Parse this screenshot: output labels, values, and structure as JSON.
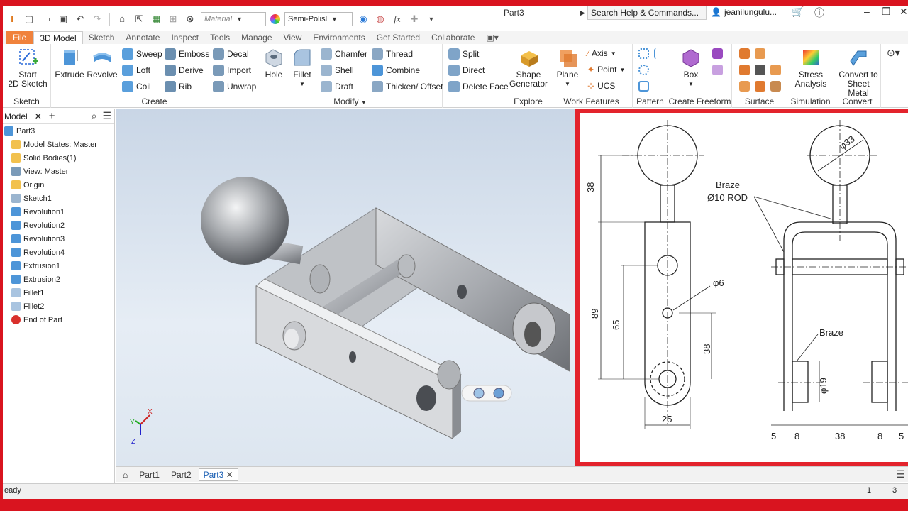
{
  "qat": {
    "material_placeholder": "Material",
    "appearance_value": "Semi-Polisl",
    "doc_title": "Part3",
    "search_placeholder": "Search Help & Commands...",
    "user_name": "jeanilungulu..."
  },
  "ribbon_tabs": [
    "File",
    "3D Model",
    "Sketch",
    "Annotate",
    "Inspect",
    "Tools",
    "Manage",
    "View",
    "Environments",
    "Get Started",
    "Collaborate"
  ],
  "ribbon": {
    "sketch": {
      "label": "Sketch",
      "start_line1": "Start",
      "start_line2": "2D Sketch"
    },
    "create": {
      "label": "Create",
      "extrude": "Extrude",
      "revolve": "Revolve",
      "sweep": "Sweep",
      "loft": "Loft",
      "coil": "Coil",
      "emboss": "Emboss",
      "derive": "Derive",
      "rib": "Rib",
      "decal": "Decal",
      "import": "Import",
      "unwrap": "Unwrap"
    },
    "modify": {
      "label": "Modify",
      "hole": "Hole",
      "fillet": "Fillet",
      "chamfer": "Chamfer",
      "shell": "Shell",
      "draft": "Draft",
      "thread": "Thread",
      "combine": "Combine",
      "thicken": "Thicken/ Offset",
      "split": "Split",
      "direct": "Direct",
      "delete_face": "Delete Face"
    },
    "explore": {
      "label": "Explore",
      "shape_line1": "Shape",
      "shape_line2": "Generator"
    },
    "work_features": {
      "label": "Work Features",
      "plane": "Plane",
      "axis": "Axis",
      "point": "Point",
      "ucs": "UCS"
    },
    "pattern": {
      "label": "Pattern"
    },
    "freeform": {
      "label": "Create Freeform",
      "box": "Box"
    },
    "surface": {
      "label": "Surface"
    },
    "simulation": {
      "label": "Simulation",
      "stress_line1": "Stress",
      "stress_line2": "Analysis"
    },
    "convert": {
      "label": "Convert",
      "convert_line1": "Convert to",
      "convert_line2": "Sheet Metal"
    }
  },
  "browser": {
    "tab_label": "Model",
    "items": [
      {
        "label": "Part3",
        "icon": "part-icon"
      },
      {
        "label": "Model States: Master",
        "icon": "folder-icon"
      },
      {
        "label": "Solid Bodies(1)",
        "icon": "folder-icon"
      },
      {
        "label": "View: Master",
        "icon": "view-icon"
      },
      {
        "label": "Origin",
        "icon": "folder-icon"
      },
      {
        "label": "Sketch1",
        "icon": "sketch-icon"
      },
      {
        "label": "Revolution1",
        "icon": "revolve-icon"
      },
      {
        "label": "Revolution2",
        "icon": "revolve-icon"
      },
      {
        "label": "Revolution3",
        "icon": "revolve-icon"
      },
      {
        "label": "Revolution4",
        "icon": "revolve-icon"
      },
      {
        "label": "Extrusion1",
        "icon": "extrude-icon"
      },
      {
        "label": "Extrusion2",
        "icon": "extrude-icon"
      },
      {
        "label": "Fillet1",
        "icon": "fillet-icon"
      },
      {
        "label": "Fillet2",
        "icon": "fillet-icon"
      },
      {
        "label": "End of Part",
        "icon": "end-of-part-icon"
      }
    ]
  },
  "drawing": {
    "dim_38_top": "38",
    "dim_89": "89",
    "dim_65": "65",
    "dim_38_lower": "38",
    "dim_25": "25",
    "phi_6": "φ6",
    "phi_33": "φ33",
    "braze_top": "Braze",
    "rod": "Ø10 ROD",
    "braze_mid": "Braze",
    "phi_19": "φ19",
    "bottom_dims": [
      "5",
      "8",
      "38",
      "8",
      "5"
    ]
  },
  "doc_tabs": [
    "Part1",
    "Part2",
    "Part3"
  ],
  "status": {
    "text": "eady",
    "count1": "1",
    "count2": "3"
  }
}
